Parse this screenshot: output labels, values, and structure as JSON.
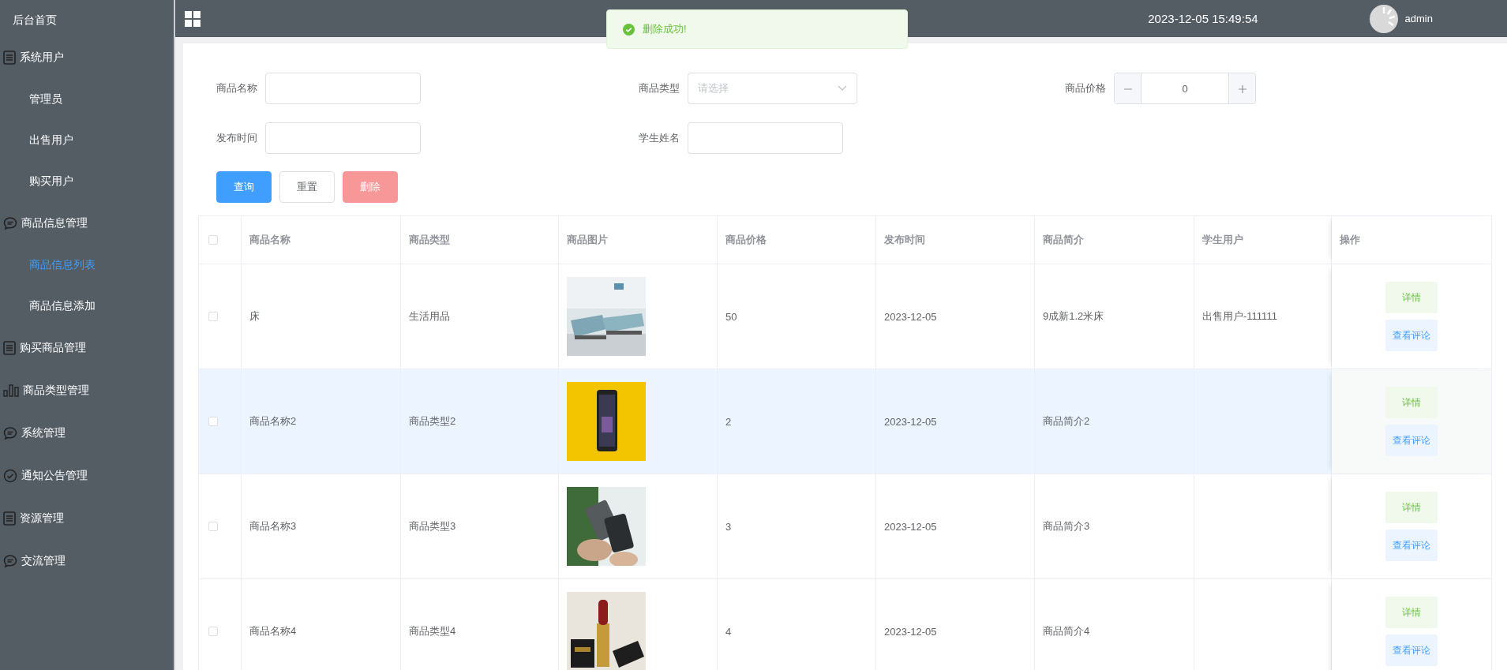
{
  "sidebar": {
    "items": [
      {
        "label": "后台首页",
        "kind": "home",
        "selected": false
      },
      {
        "label": "系统用户",
        "kind": "list",
        "selected": false,
        "children": [
          {
            "label": "管理员",
            "selected": false
          },
          {
            "label": "出售用户",
            "selected": false
          },
          {
            "label": "购买用户",
            "selected": false
          }
        ]
      },
      {
        "label": "商品信息管理",
        "kind": "chat",
        "selected": false,
        "children": [
          {
            "label": "商品信息列表",
            "selected": true
          },
          {
            "label": "商品信息添加",
            "selected": false
          }
        ]
      },
      {
        "label": "购买商品管理",
        "kind": "list",
        "selected": false
      },
      {
        "label": "商品类型管理",
        "kind": "chart",
        "selected": false
      },
      {
        "label": "系统管理",
        "kind": "chat",
        "selected": false
      },
      {
        "label": "通知公告管理",
        "kind": "check",
        "selected": false
      },
      {
        "label": "资源管理",
        "kind": "list",
        "selected": false
      },
      {
        "label": "交流管理",
        "kind": "chat",
        "selected": false
      }
    ]
  },
  "top_bar": {
    "datetime": "2023-12-05 15:49:54",
    "user": "admin"
  },
  "toast": {
    "kind": "success",
    "message": "删除成功!"
  },
  "search_form": {
    "fields": [
      {
        "label": "商品名称",
        "kind": "text"
      },
      {
        "label": "商品类型",
        "kind": "select",
        "placeholder": "请选择"
      },
      {
        "label": "商品价格",
        "kind": "stepper",
        "value": "0"
      },
      {
        "label": "发布时间",
        "kind": "text"
      },
      {
        "label": "学生姓名",
        "kind": "text"
      }
    ],
    "buttons": [
      {
        "label": "查询",
        "kind": "primary",
        "disabled": false
      },
      {
        "label": "重置",
        "kind": "default",
        "disabled": false
      },
      {
        "label": "删除",
        "kind": "danger",
        "disabled": true
      }
    ]
  },
  "table": {
    "all_checked": false,
    "columns": [
      "商品名称",
      "商品类型",
      "商品图片",
      "商品价格",
      "发布时间",
      "商品简介",
      "学生用户",
      "操作"
    ],
    "rows": [
      {
        "checked": false,
        "highlighted": false,
        "name": "床",
        "type": "生活用品",
        "image": {
          "kind": "picture"
        },
        "price": "50",
        "time": "2023-12-05",
        "intro": "9成新1.2米床",
        "user": "出售用户-111111",
        "actions": [
          "详情",
          "查看评论"
        ]
      },
      {
        "checked": false,
        "highlighted": true,
        "name": "商品名称2",
        "type": "商品类型2",
        "image": {
          "kind": "picture"
        },
        "price": "2",
        "time": "2023-12-05",
        "intro": "商品简介2",
        "user": "",
        "actions": [
          "详情",
          "查看评论"
        ]
      },
      {
        "checked": false,
        "highlighted": false,
        "name": "商品名称3",
        "type": "商品类型3",
        "image": {
          "kind": "picture"
        },
        "price": "3",
        "time": "2023-12-05",
        "intro": "商品简介3",
        "user": "",
        "actions": [
          "详情",
          "查看评论"
        ]
      },
      {
        "checked": false,
        "highlighted": false,
        "name": "商品名称4",
        "type": "商品类型4",
        "image": {
          "kind": "picture"
        },
        "price": "4",
        "time": "2023-12-05",
        "intro": "商品简介4",
        "user": "",
        "actions": [
          "详情",
          "查看评论"
        ]
      }
    ]
  }
}
